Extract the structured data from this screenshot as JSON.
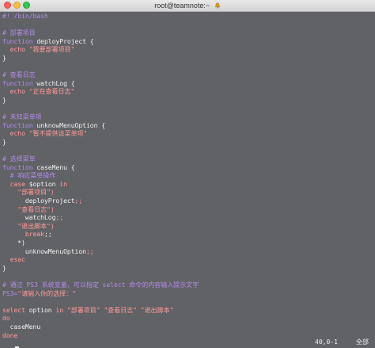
{
  "window": {
    "title": "root@teamnote:~",
    "bell_icon": "bell-icon"
  },
  "editor": {
    "lines": [
      {
        "segments": [
          {
            "cls": "c",
            "text": "#! /bin/bash"
          }
        ]
      },
      {
        "segments": []
      },
      {
        "segments": [
          {
            "cls": "c",
            "text": "# 部署项目"
          }
        ]
      },
      {
        "segments": [
          {
            "cls": "k",
            "text": "function "
          },
          {
            "cls": "t",
            "text": "deployProject {"
          }
        ]
      },
      {
        "segments": [
          {
            "cls": "t",
            "text": "  "
          },
          {
            "cls": "s",
            "text": "echo \"我要部署项目\""
          }
        ]
      },
      {
        "segments": [
          {
            "cls": "t",
            "text": "}"
          }
        ]
      },
      {
        "segments": []
      },
      {
        "segments": [
          {
            "cls": "c",
            "text": "# 查看日志"
          }
        ]
      },
      {
        "segments": [
          {
            "cls": "k",
            "text": "function "
          },
          {
            "cls": "t",
            "text": "watchLog {"
          }
        ]
      },
      {
        "segments": [
          {
            "cls": "t",
            "text": "  "
          },
          {
            "cls": "s",
            "text": "echo \"正在查看日志\""
          }
        ]
      },
      {
        "segments": [
          {
            "cls": "t",
            "text": "}"
          }
        ]
      },
      {
        "segments": []
      },
      {
        "segments": [
          {
            "cls": "c",
            "text": "# 未知菜单项"
          }
        ]
      },
      {
        "segments": [
          {
            "cls": "k",
            "text": "function "
          },
          {
            "cls": "t",
            "text": "unknowMenuOption {"
          }
        ]
      },
      {
        "segments": [
          {
            "cls": "t",
            "text": "  "
          },
          {
            "cls": "s",
            "text": "echo \"暂不提供该菜单项\""
          }
        ]
      },
      {
        "segments": [
          {
            "cls": "t",
            "text": "}"
          }
        ]
      },
      {
        "segments": []
      },
      {
        "segments": [
          {
            "cls": "c",
            "text": "# 选择菜单"
          }
        ]
      },
      {
        "segments": [
          {
            "cls": "k",
            "text": "function "
          },
          {
            "cls": "t",
            "text": "caseMenu {"
          }
        ]
      },
      {
        "segments": [
          {
            "cls": "t",
            "text": "  "
          },
          {
            "cls": "c",
            "text": "# 响应菜单操作"
          }
        ]
      },
      {
        "segments": [
          {
            "cls": "t",
            "text": "  "
          },
          {
            "cls": "s",
            "text": "case "
          },
          {
            "cls": "t",
            "text": "$option "
          },
          {
            "cls": "s",
            "text": "in"
          }
        ]
      },
      {
        "segments": [
          {
            "cls": "t",
            "text": "    "
          },
          {
            "cls": "s",
            "text": "\"部署项目\")"
          }
        ]
      },
      {
        "segments": [
          {
            "cls": "t",
            "text": "      deployProject"
          },
          {
            "cls": "s",
            "text": ";;"
          }
        ]
      },
      {
        "segments": [
          {
            "cls": "t",
            "text": "    "
          },
          {
            "cls": "s",
            "text": "\"查看日志\")"
          }
        ]
      },
      {
        "segments": [
          {
            "cls": "t",
            "text": "      watchLog"
          },
          {
            "cls": "s",
            "text": ";;"
          }
        ]
      },
      {
        "segments": [
          {
            "cls": "t",
            "text": "    "
          },
          {
            "cls": "s",
            "text": "\"退出脚本\")"
          }
        ]
      },
      {
        "segments": [
          {
            "cls": "t",
            "text": "      "
          },
          {
            "cls": "s",
            "text": "break"
          },
          {
            "cls": "t",
            "text": ";;"
          }
        ]
      },
      {
        "segments": [
          {
            "cls": "t",
            "text": "    *)"
          }
        ]
      },
      {
        "segments": [
          {
            "cls": "t",
            "text": "      unknowMenuOption"
          },
          {
            "cls": "s",
            "text": ";;"
          }
        ]
      },
      {
        "segments": [
          {
            "cls": "t",
            "text": "  "
          },
          {
            "cls": "s",
            "text": "esac"
          }
        ]
      },
      {
        "segments": [
          {
            "cls": "t",
            "text": "}"
          }
        ]
      },
      {
        "segments": []
      },
      {
        "segments": [
          {
            "cls": "c",
            "text": "# 通过 PS3 系统变量，可以指定 select 命令的内容输入提示文字"
          }
        ]
      },
      {
        "segments": [
          {
            "cls": "k",
            "text": "PS3="
          },
          {
            "cls": "s",
            "text": "\"请输入你的选择：\""
          }
        ]
      },
      {
        "segments": []
      },
      {
        "segments": [
          {
            "cls": "s",
            "text": "select "
          },
          {
            "cls": "t",
            "text": "option "
          },
          {
            "cls": "s",
            "text": "in \"部署项目\" \"查看日志\" \"退出脚本\""
          }
        ]
      },
      {
        "segments": [
          {
            "cls": "s",
            "text": "do"
          }
        ]
      },
      {
        "segments": [
          {
            "cls": "t",
            "text": "  caseMenu"
          }
        ]
      },
      {
        "segments": [
          {
            "cls": "s",
            "text": "done"
          }
        ]
      }
    ]
  },
  "status": {
    "position": "40,0-1",
    "mode": "全部"
  }
}
